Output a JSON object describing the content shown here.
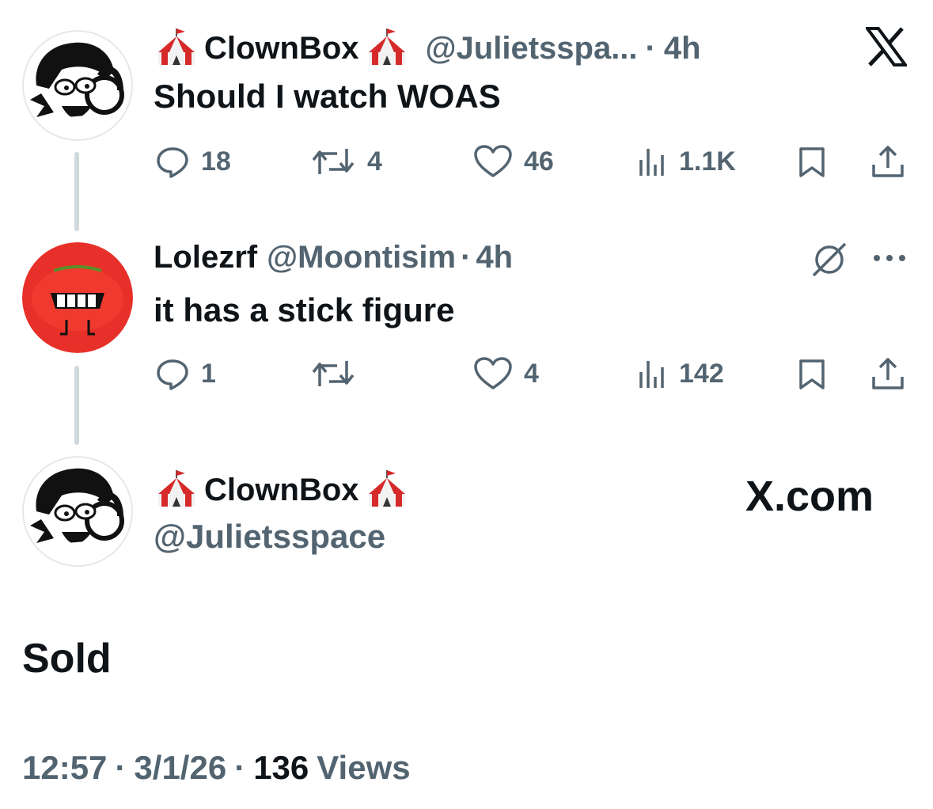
{
  "tweet1": {
    "display_name": "ClownBox",
    "name_emoji": "circus-tent-icon",
    "handle": "@Julietsspa...",
    "sep": "·",
    "time": "4h",
    "text": "Should I watch WOAS",
    "replies": "18",
    "retweets": "4",
    "likes": "46",
    "views": "1.1K"
  },
  "tweet2": {
    "display_name": "Lolezrf",
    "handle": "@Moontisim",
    "sep": "·",
    "time": "4h",
    "text": "it has a stick figure",
    "replies": "1",
    "likes": "4",
    "views": "142"
  },
  "main": {
    "display_name": "ClownBox",
    "handle": "@Julietsspace",
    "brand": "X.com",
    "text": "Sold",
    "time": "12:57",
    "sep": "·",
    "date": "3/1/26",
    "views_count": "136",
    "views_label": "Views"
  },
  "colors": {
    "text": "#0f1419",
    "muted": "#536471",
    "thread_line": "#cfd9de",
    "tomato": "#e8302a"
  }
}
